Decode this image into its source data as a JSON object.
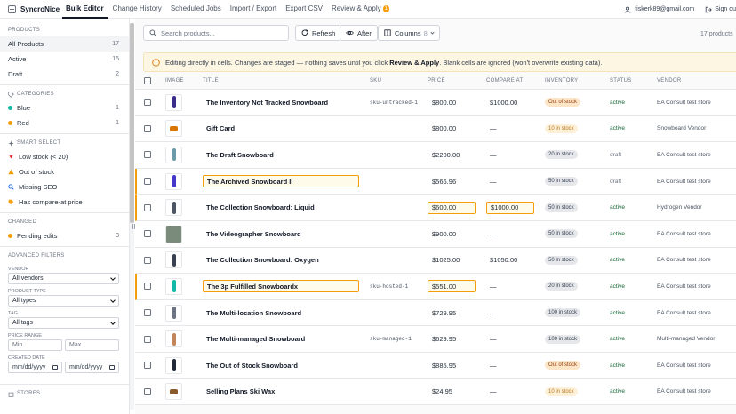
{
  "app": {
    "name": "SyncroNice"
  },
  "nav": {
    "tabs": [
      {
        "label": "Bulk Editor",
        "active": true
      },
      {
        "label": "Change History"
      },
      {
        "label": "Scheduled Jobs"
      },
      {
        "label": "Import / Export"
      },
      {
        "label": "Export CSV"
      },
      {
        "label": "Review & Apply",
        "badge": "1"
      }
    ]
  },
  "account": {
    "email": "fiskerk89@gmail.com",
    "signout_label": "Sign ou"
  },
  "sidebar": {
    "products_header": "PRODUCTS",
    "products": [
      {
        "label": "All Products",
        "count": "17",
        "active": true
      },
      {
        "label": "Active",
        "count": "15"
      },
      {
        "label": "Draft",
        "count": "2"
      }
    ],
    "categories_header": "CATEGORIES",
    "categories": [
      {
        "label": "Blue",
        "count": "1",
        "color": "#14b8a6"
      },
      {
        "label": "Red",
        "count": "1",
        "color": "#f59e0b"
      }
    ],
    "smart_header": "SMART SELECT",
    "smart": [
      {
        "label": "Low stock (< 20)",
        "icon": "arrow-down-icon"
      },
      {
        "label": "Out of stock",
        "icon": "warning-icon"
      },
      {
        "label": "Missing SEO",
        "icon": "search-icon"
      },
      {
        "label": "Has compare-at price",
        "icon": "tag-icon"
      }
    ],
    "changed_header": "CHANGED",
    "changed": [
      {
        "label": "Pending edits",
        "count": "3",
        "color": "#f59e0b"
      }
    ],
    "advanced_header": "ADVANCED FILTERS",
    "vendor_label": "VENDOR",
    "vendor_value": "All vendors",
    "type_label": "PRODUCT TYPE",
    "type_value": "All types",
    "tag_label": "TAG",
    "tag_value": "All tags",
    "price_label": "PRICE RANGE",
    "min_placeholder": "Min",
    "max_placeholder": "Max",
    "date_label": "CREATED DATE",
    "date_from": "mm/dd/yyyy",
    "date_to": "mm/dd/yyyy",
    "stores_header": "STORES"
  },
  "toolbar": {
    "search_placeholder": "Search products...",
    "refresh_label": "Refresh",
    "after_label": "After",
    "columns_label": "Columns",
    "columns_count": "8",
    "product_count": "17 products"
  },
  "banner": {
    "text_before": "Editing directly in cells. Changes are staged — nothing saves until you click ",
    "action": "Review & Apply",
    "text_after": ". Blank cells are ignored (won't overwrite existing data)."
  },
  "table": {
    "headers": {
      "image": "IMAGE",
      "title": "TITLE",
      "sku": "SKU",
      "price": "PRICE",
      "compare": "COMPARE AT",
      "inventory": "INVENTORY",
      "status": "STATUS",
      "vendor": "VENDOR"
    },
    "rows": [
      {
        "title": "The Inventory Not Tracked Snowboard",
        "sku": "sku-untracked-1",
        "price": "$800.00",
        "compare": "$1000.00",
        "inventory": "Out of stock",
        "inv_kind": "out",
        "status": "active",
        "vendor": "EA Consult test store",
        "img": "#3b2d8a"
      },
      {
        "title": "Gift Card",
        "sku": "",
        "price": "$800.00",
        "compare": "—",
        "inventory": "10 in stock",
        "inv_kind": "low",
        "status": "active",
        "vendor": "Snowboard Vendor",
        "img": "#d97706"
      },
      {
        "title": "The Draft Snowboard",
        "sku": "",
        "price": "$2200.00",
        "compare": "—",
        "inventory": "20 in stock",
        "inv_kind": "in",
        "status": "draft",
        "vendor": "EA Consult test store",
        "img": "#6b9aa8"
      },
      {
        "title": "The Archived Snowboard II",
        "sku": "",
        "price": "$566.96",
        "compare": "—",
        "inventory": "50 in stock",
        "inv_kind": "in",
        "status": "draft",
        "vendor": "EA Consult test store",
        "img": "#4338ca",
        "edited": true,
        "edit_title": true
      },
      {
        "title": "The Collection Snowboard: Liquid",
        "sku": "",
        "price": "$600.00",
        "compare": "$1000.00",
        "inventory": "50 in stock",
        "inv_kind": "in",
        "status": "active",
        "vendor": "Hydrogen Vendor",
        "img": "#4b5563",
        "edited": true,
        "edit_price": true,
        "edit_compare": true
      },
      {
        "title": "The Videographer Snowboard",
        "sku": "",
        "price": "$900.00",
        "compare": "—",
        "inventory": "50 in stock",
        "inv_kind": "in",
        "status": "active",
        "vendor": "EA Consult test store",
        "img": "#7a8b7c"
      },
      {
        "title": "The Collection Snowboard: Oxygen",
        "sku": "",
        "price": "$1025.00",
        "compare": "$1050.00",
        "inventory": "50 in stock",
        "inv_kind": "in",
        "status": "active",
        "vendor": "EA Consult test store",
        "img": "#374151"
      },
      {
        "title": "The 3p Fulfilled Snowboardx",
        "sku": "sku-hosted-1",
        "price": "$551.00",
        "compare": "—",
        "inventory": "20 in stock",
        "inv_kind": "in",
        "status": "active",
        "vendor": "EA Consult test store",
        "img": "#14b8a6",
        "edited": true,
        "edit_title": true,
        "edit_price": true
      },
      {
        "title": "The Multi-location Snowboard",
        "sku": "",
        "price": "$729.95",
        "compare": "—",
        "inventory": "100 in stock",
        "inv_kind": "in",
        "status": "active",
        "vendor": "EA Consult test store",
        "img": "#6b7280"
      },
      {
        "title": "The Multi-managed Snowboard",
        "sku": "sku-managed-1",
        "price": "$629.95",
        "compare": "—",
        "inventory": "100 in stock",
        "inv_kind": "in",
        "status": "active",
        "vendor": "Multi-managed Vendor",
        "img": "#c2855a"
      },
      {
        "title": "The Out of Stock Snowboard",
        "sku": "",
        "price": "$885.95",
        "compare": "—",
        "inventory": "Out of stock",
        "inv_kind": "out",
        "status": "active",
        "vendor": "EA Consult test store",
        "img": "#1f2937"
      },
      {
        "title": "Selling Plans Ski Wax",
        "sku": "",
        "price": "$24.95",
        "compare": "—",
        "inventory": "10 in stock",
        "inv_kind": "low",
        "status": "active",
        "vendor": "EA Consult test store",
        "img": "#8a5a2b"
      }
    ]
  }
}
